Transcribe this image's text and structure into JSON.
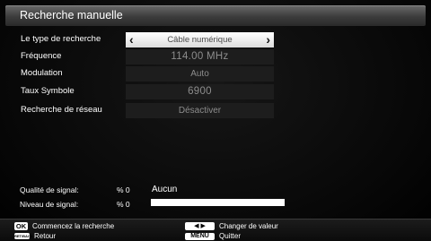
{
  "title": "Recherche manuelle",
  "rows": [
    {
      "label": "Le type de recherche",
      "value": "Câble numérique",
      "selected": true
    },
    {
      "label": "Fréquence",
      "value": "114.00 MHz"
    },
    {
      "label": "Modulation",
      "value": "Auto"
    },
    {
      "label": "Taux Symbole",
      "value": "6900"
    },
    {
      "label": "Recherche de réseau",
      "value": "Désactiver"
    }
  ],
  "arrows": {
    "left": "‹",
    "right": "›"
  },
  "signal": {
    "quality_label": "Qualité de signal:",
    "quality_pct": "% 0",
    "quality_text": "Aucun",
    "level_label": "Niveau de signal:",
    "level_pct": "% 0",
    "level_fraction": 0
  },
  "footer": {
    "ok_key": "OK",
    "ok_text": "Commencez la recherche",
    "back_key": "RET/BACK",
    "back_text": "Retour",
    "arrows_key": "◀ ▶",
    "arrows_text": "Changer de valeur",
    "menu_key": "MENU",
    "menu_text": "Quitter"
  }
}
